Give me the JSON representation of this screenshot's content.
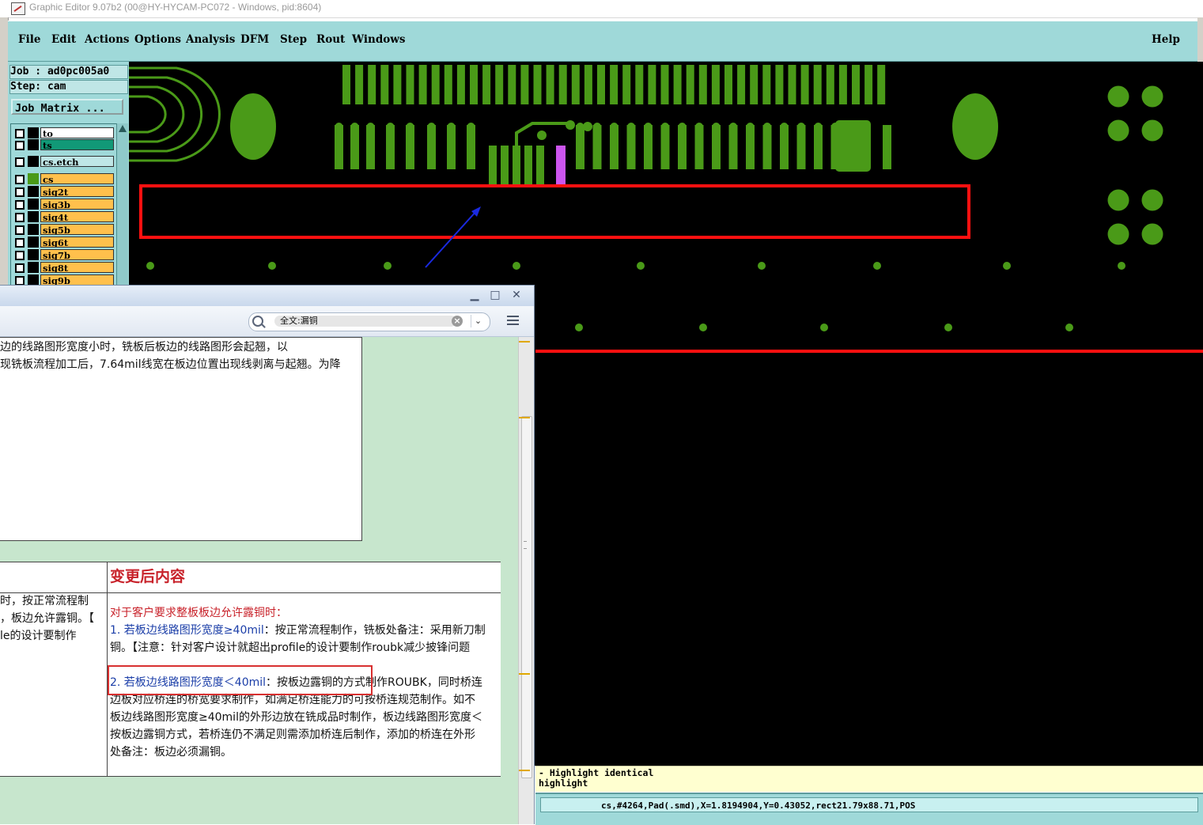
{
  "window": {
    "title": "Graphic Editor 9.07b2 (00@HY-HYCAM-PC072 - Windows, pid:8604)"
  },
  "menu": {
    "items": [
      "File",
      "Edit",
      "Actions",
      "Options",
      "Analysis",
      "DFM",
      "Step",
      "Rout",
      "Windows"
    ],
    "help": "Help"
  },
  "job_panel": {
    "job": "Job : ad0pc005a0",
    "step": "Step: cam",
    "job_matrix_button": "Job Matrix ..."
  },
  "layers": [
    {
      "name": "to",
      "color": "#ffffff"
    },
    {
      "name": "ts",
      "color": "#119977"
    },
    {
      "name": "cs.etch",
      "color": "#bfe6e6"
    },
    {
      "name": "cs",
      "color": "#ffc04c"
    },
    {
      "name": "sig2t",
      "color": "#ffc04c"
    },
    {
      "name": "sig3b",
      "color": "#ffc04c"
    },
    {
      "name": "sig4t",
      "color": "#ffc04c"
    },
    {
      "name": "sig5b",
      "color": "#ffc04c"
    },
    {
      "name": "sig6t",
      "color": "#ffc04c"
    },
    {
      "name": "sig7b",
      "color": "#ffc04c"
    },
    {
      "name": "sig8t",
      "color": "#ffc04c"
    },
    {
      "name": "sig9b",
      "color": "#ffc04c"
    }
  ],
  "messages": {
    "line1": "- Highlight identical",
    "line2": "highlight"
  },
  "status": {
    "coords": "cs,#4264,Pad(.smd),X=1.8194904,Y=0.43052,rect21.79x88.71,POS"
  },
  "doc_viewer": {
    "search_query": "全文:漏铜",
    "paragraph": [
      "边的线路图形宽度小时，铣板后板边的线路图形会起翘，以",
      "现铣板流程加工后，7.64mil线宽在板边位置出现线剥离与起翘。为降"
    ],
    "header_after": "变更后内容",
    "left_col": [
      "时，按正常流程制",
      "，板边允许露铜。【",
      "le的设计要制作"
    ],
    "right_col": {
      "intro": "对于客户要求整板板边允许露铜时：",
      "item1_lead": "1. 若板边线路图形宽度≥40mil",
      "item1_rest": "：按正常流程制作，铣板处备注：采用新刀制",
      "item1_line2": "铜。【注意：针对客户设计就超出profile的设计要制作roubk减少披锋问题",
      "item2_lead": "2. 若板边线路图形宽度＜40mil",
      "item2_rest": "：按板边露铜的方式制作ROUBK，同时桥连",
      "lines": [
        "边板对应桥连的桥宽要求制作，如满足桥连能力的可按桥连规范制作。如不",
        "板边线路图形宽度≥40mil的外形边放在铣成品时制作，板边线路图形宽度＜",
        "按板边露铜方式，若桥连仍不满足则需添加桥连后制作，添加的桥连在外形",
        "处备注：板边必须漏铜。"
      ]
    }
  },
  "colors": {
    "cam_panel": "#9fd9d9",
    "pad_green": "#4a9a18",
    "highlight_red": "#ff1010",
    "doc_bg": "#c7e6cd"
  }
}
